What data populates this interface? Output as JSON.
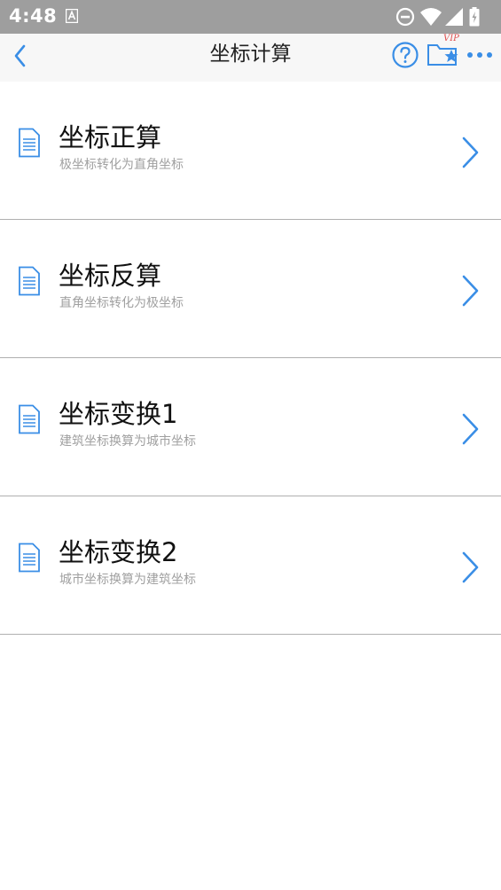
{
  "status_bar": {
    "time": "4:48",
    "icons": [
      "notification-a-icon",
      "do-not-disturb-icon",
      "wifi-icon",
      "signal-icon",
      "battery-icon"
    ]
  },
  "header": {
    "title": "坐标计算",
    "back_icon": "chevron-left-icon",
    "help_icon": "question-circle-icon",
    "favorites_icon": "folder-star-icon",
    "favorites_badge": "VIP",
    "more_icon": "more-dots-icon"
  },
  "colors": {
    "accent": "#3a8ee6",
    "status_bar_bg": "#9e9e9e",
    "header_bg": "#f7f7f7",
    "vip_badge": "#e05050",
    "subtitle_text": "#a0a0a0",
    "divider": "#b0b0b0"
  },
  "menu": {
    "items": [
      {
        "title": "坐标正算",
        "subtitle": "极坐标转化为直角坐标",
        "icon": "document-icon"
      },
      {
        "title": "坐标反算",
        "subtitle": "直角坐标转化为极坐标",
        "icon": "document-icon"
      },
      {
        "title": "坐标变换1",
        "subtitle": "建筑坐标换算为城市坐标",
        "icon": "document-icon"
      },
      {
        "title": "坐标变换2",
        "subtitle": "城市坐标换算为建筑坐标",
        "icon": "document-icon"
      }
    ]
  }
}
